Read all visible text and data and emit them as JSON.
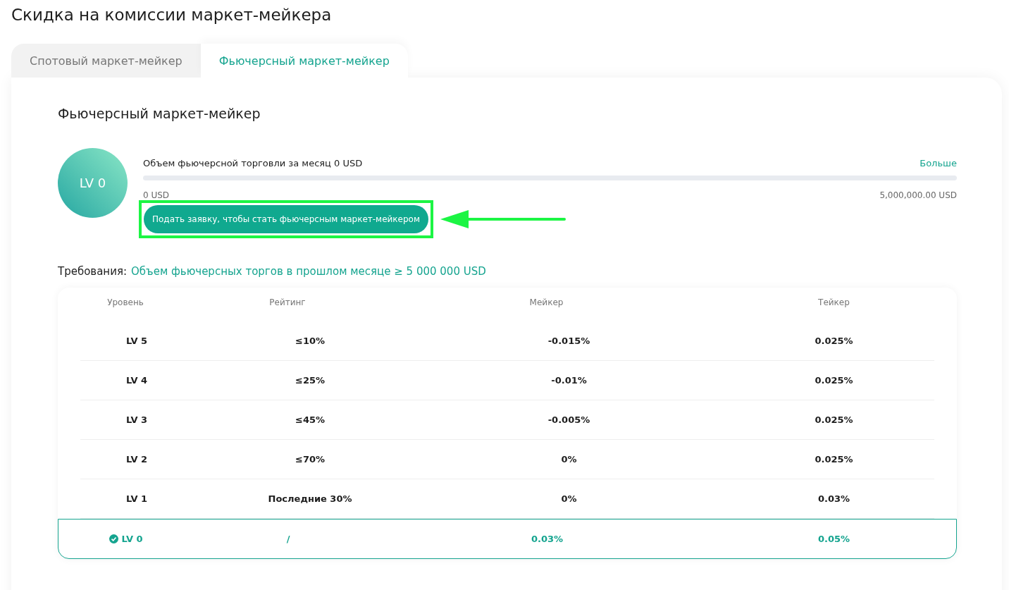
{
  "page_title": "Скидка на комиссии маркет-мейкера",
  "tabs": [
    {
      "label": "Спотовый маркет-мейкер",
      "selected": false
    },
    {
      "label": "Фьючерсный маркет-мейкер",
      "selected": true
    }
  ],
  "section_title": "Фьючерсный маркет-мейкер",
  "level_badge": "LV 0",
  "volume": {
    "label": "Объем фьючерсной торговли за месяц 0 USD",
    "more_link": "Больше",
    "min": "0 USD",
    "max": "5,000,000.00 USD"
  },
  "apply_button": "Подать заявку, чтобы стать фьючерсным маркет-мейкером",
  "requirements": {
    "label": "Требования:",
    "value": "Объем фьючерсных торгов в прошлом месяце ≥ 5 000 000 USD"
  },
  "table": {
    "columns": [
      "Уровень",
      "Рейтинг",
      "Мейкер",
      "Тейкер"
    ],
    "rows": [
      {
        "level": "LV 5",
        "rating": "≤10%",
        "maker": "-0.015%",
        "taker": "0.025%",
        "current": false
      },
      {
        "level": "LV 4",
        "rating": "≤25%",
        "maker": "-0.01%",
        "taker": "0.025%",
        "current": false
      },
      {
        "level": "LV 3",
        "rating": "≤45%",
        "maker": "-0.005%",
        "taker": "0.025%",
        "current": false
      },
      {
        "level": "LV 2",
        "rating": "≤70%",
        "maker": "0%",
        "taker": "0.025%",
        "current": false
      },
      {
        "level": "LV 1",
        "rating": "Последние 30%",
        "maker": "0%",
        "taker": "0.03%",
        "current": false
      },
      {
        "level": "LV 0",
        "rating": "/",
        "maker": "0.03%",
        "taker": "0.05%",
        "current": true
      }
    ]
  }
}
